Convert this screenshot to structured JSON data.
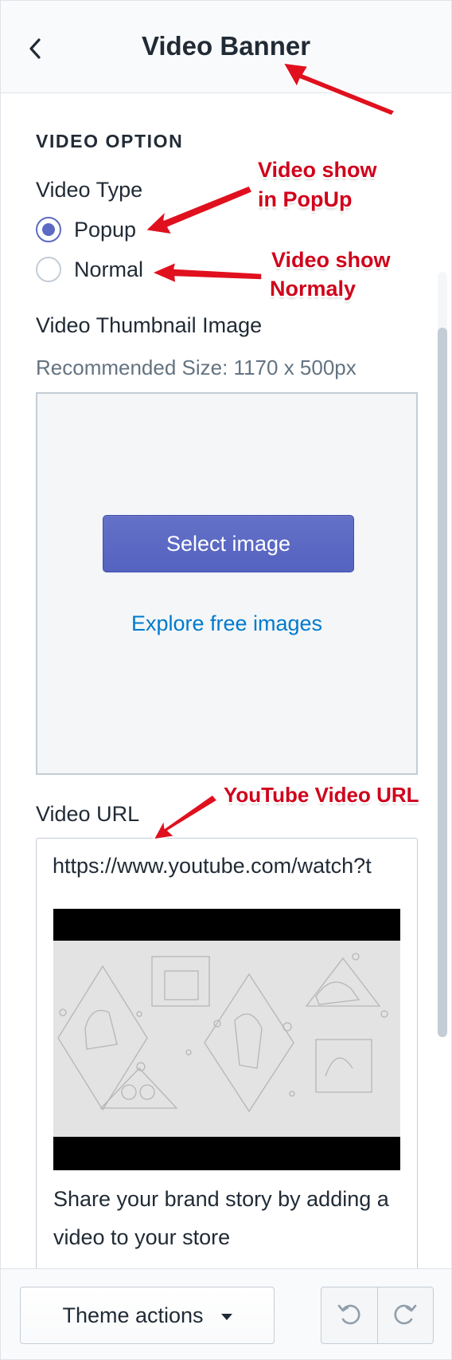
{
  "header": {
    "title": "Video Banner",
    "back_icon": "chevron-left-icon"
  },
  "section": {
    "title": "VIDEO OPTION"
  },
  "video_type": {
    "label": "Video Type",
    "options": [
      {
        "label": "Popup",
        "selected": true
      },
      {
        "label": "Normal",
        "selected": false
      }
    ]
  },
  "thumbnail": {
    "label": "Video Thumbnail Image",
    "help": "Recommended Size: 1170 x 500px",
    "select_button": "Select image",
    "explore_link": "Explore free images"
  },
  "video_url": {
    "label": "Video URL",
    "value": "https://www.youtube.com/watch?t",
    "preview_caption": "Share your brand story by adding a video to your store"
  },
  "footer": {
    "theme_actions": "Theme actions",
    "undo_icon": "undo-icon",
    "redo_icon": "redo-icon"
  },
  "annotations": {
    "popup_line1": "Video show",
    "popup_line2": "in PopUp",
    "normal_line1": "Video show",
    "normal_line2": "Normaly",
    "url_note": "YouTube Video URL"
  },
  "colors": {
    "accent": "#5c6ac4",
    "link": "#007ace",
    "annotation": "#d0021b",
    "text": "#212b36",
    "muted": "#637381"
  }
}
